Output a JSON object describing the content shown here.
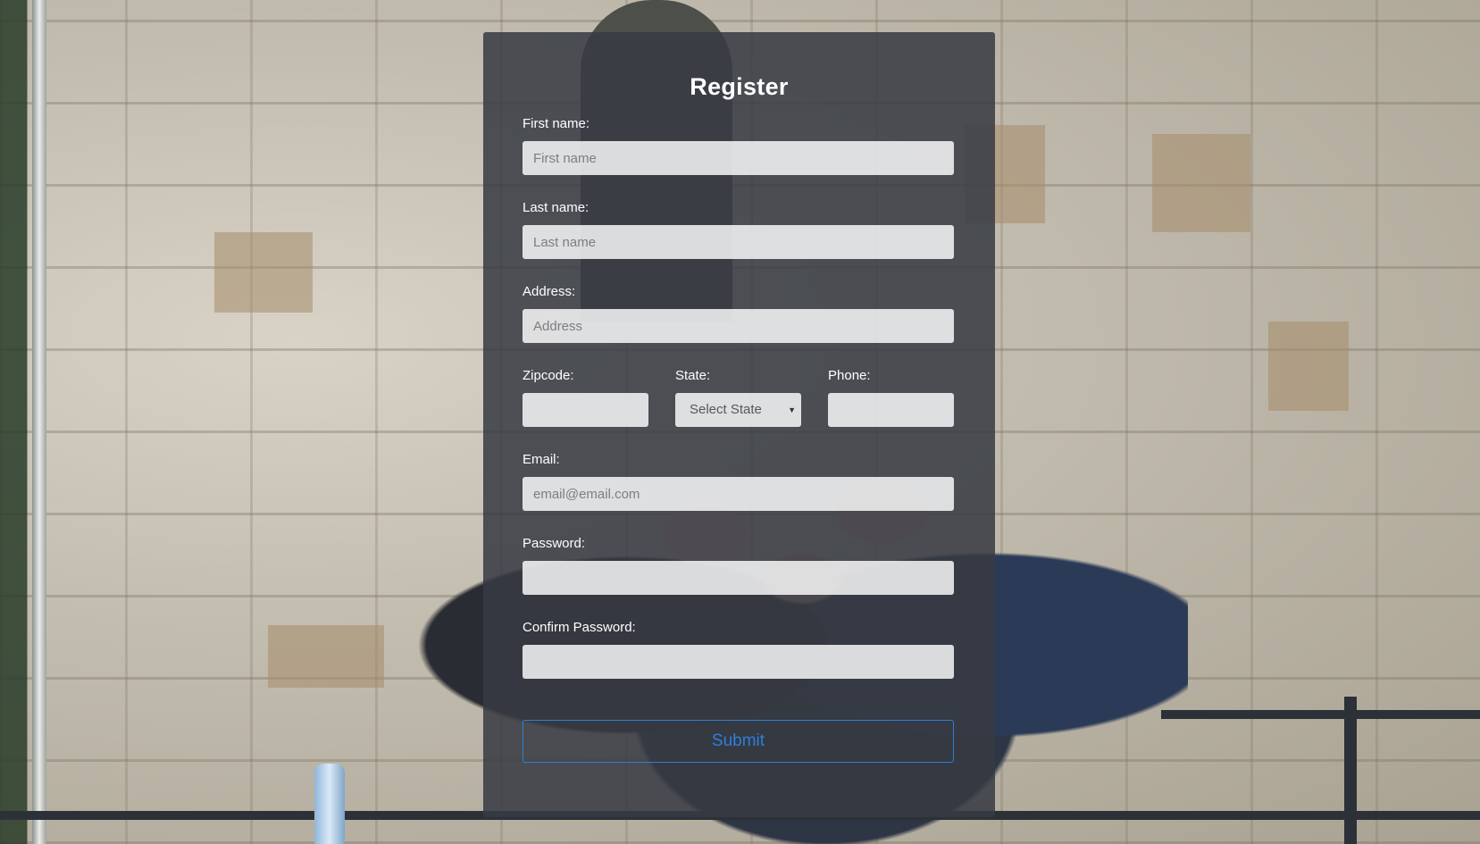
{
  "form": {
    "title": "Register",
    "first_name": {
      "label": "First name:",
      "placeholder": "First name",
      "value": ""
    },
    "last_name": {
      "label": "Last name:",
      "placeholder": "Last name",
      "value": ""
    },
    "address": {
      "label": "Address:",
      "placeholder": "Address",
      "value": ""
    },
    "zipcode": {
      "label": "Zipcode:",
      "placeholder": "",
      "value": ""
    },
    "state": {
      "label": "State:",
      "selected": "Select State",
      "caret": "▼"
    },
    "phone": {
      "label": "Phone:",
      "placeholder": "",
      "value": ""
    },
    "email": {
      "label": "Email:",
      "placeholder": "email@email.com",
      "value": ""
    },
    "password": {
      "label": "Password:",
      "placeholder": "",
      "value": ""
    },
    "confirm_password": {
      "label": "Confirm Password:",
      "placeholder": "",
      "value": ""
    },
    "submit_label": "Submit"
  },
  "colors": {
    "card_background": "#373a42",
    "submit_accent": "#2f7fd6",
    "title_text": "#ffffff"
  }
}
